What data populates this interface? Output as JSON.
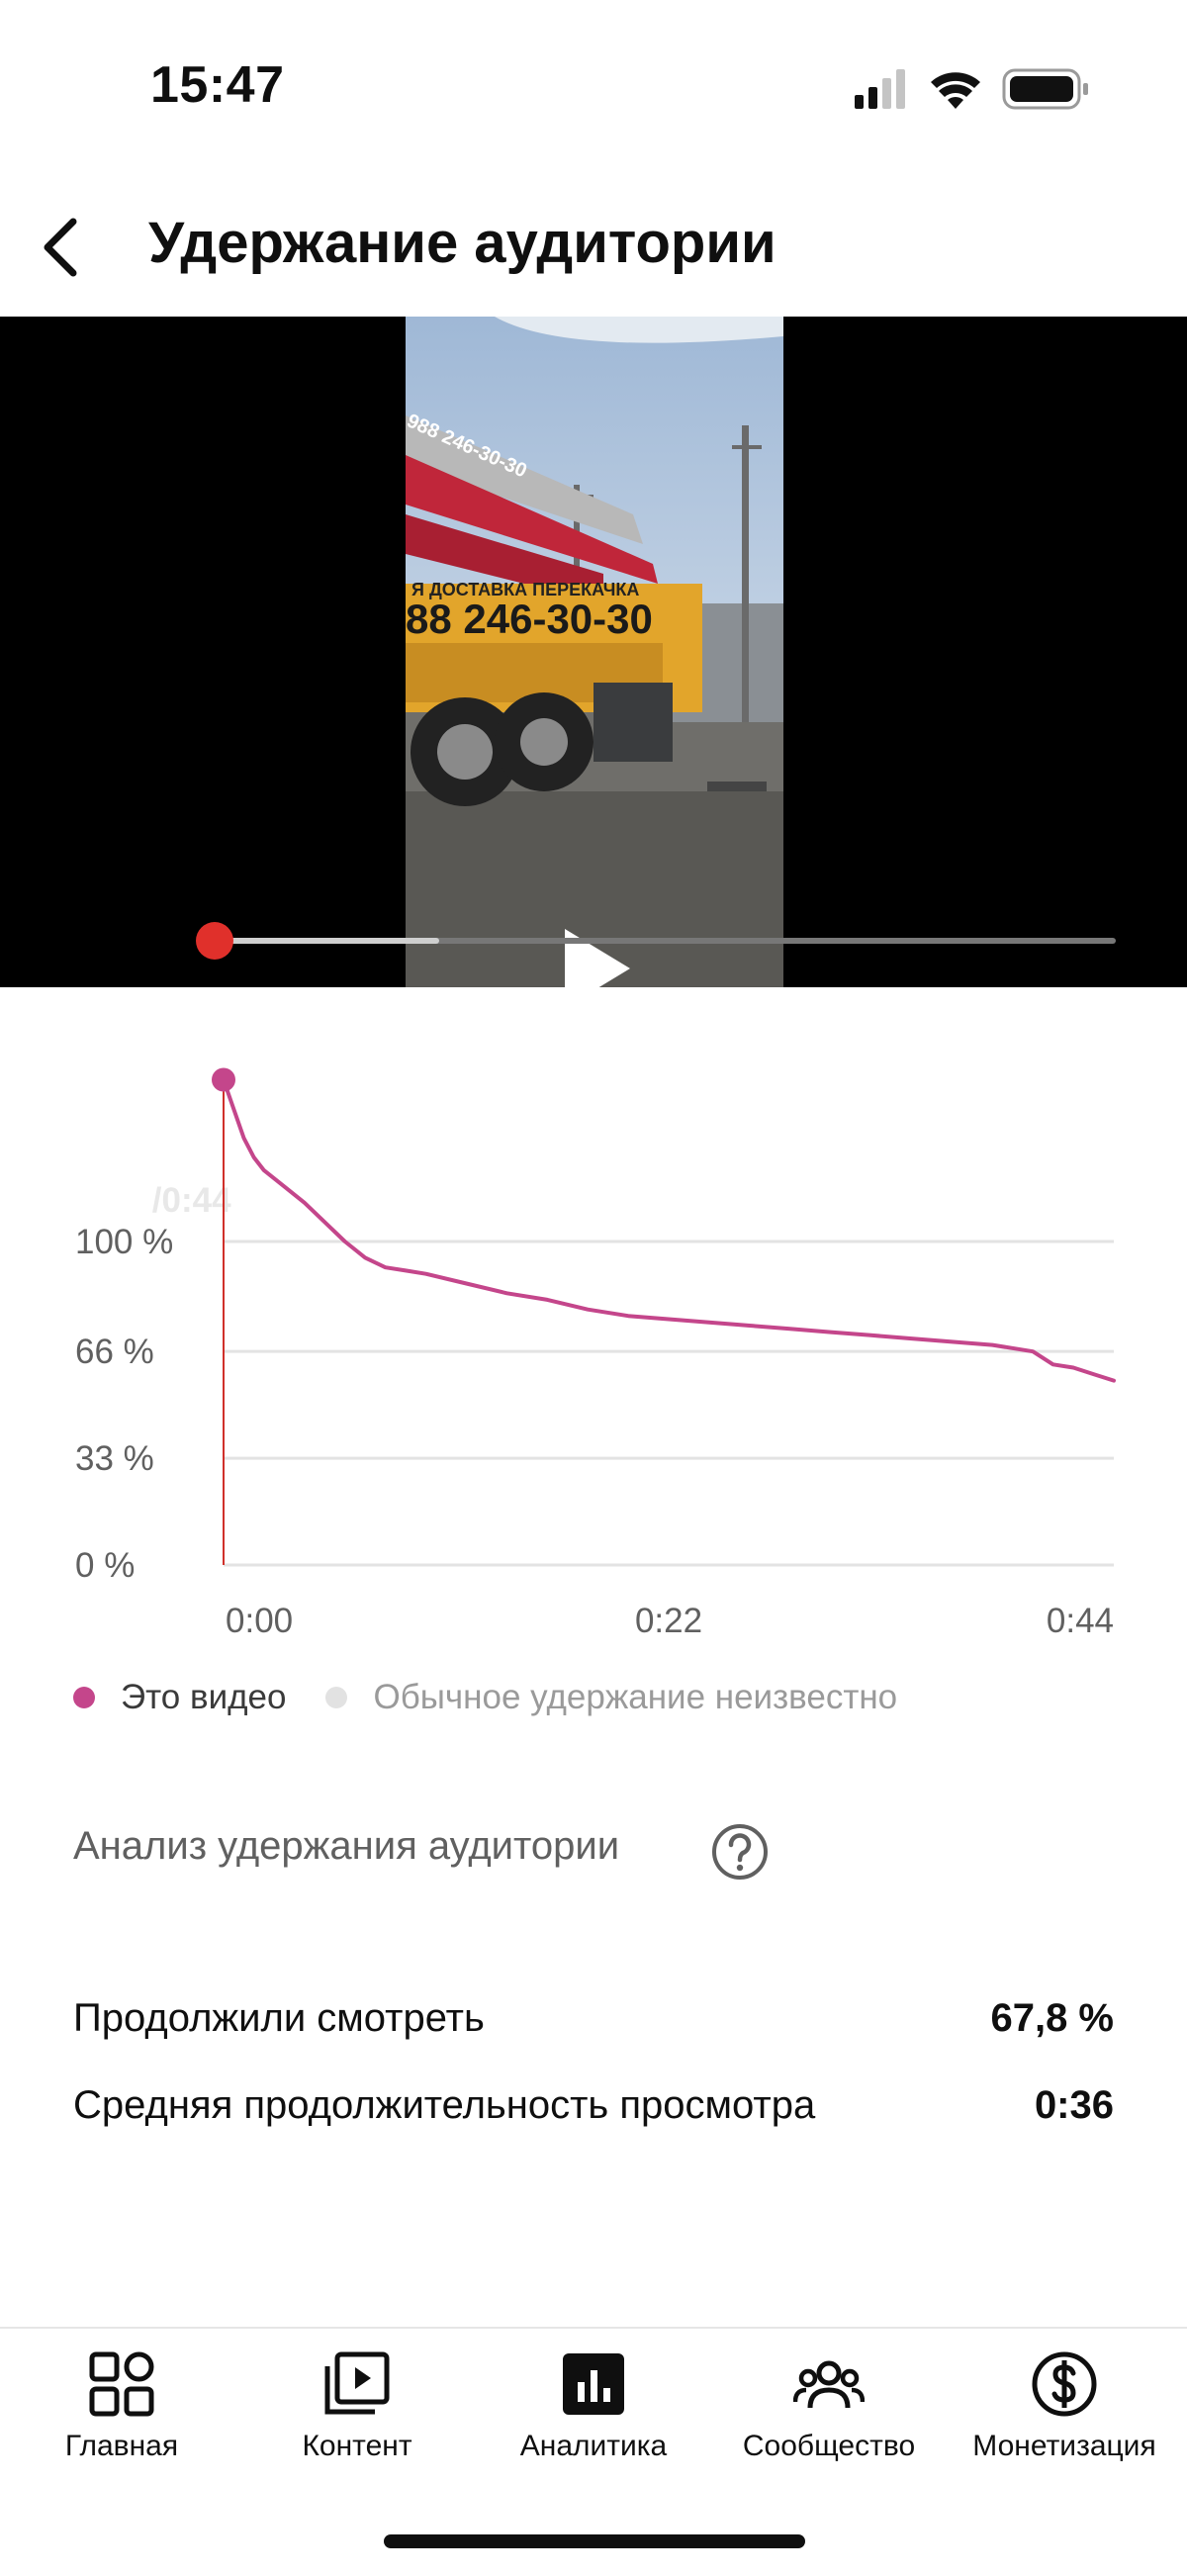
{
  "status_bar": {
    "time": "15:47"
  },
  "header": {
    "title": "Удержание аудитории"
  },
  "video": {
    "current_time": "0:00",
    "separator": "/",
    "duration": "0:44",
    "buffered_fraction": 0.25,
    "played_fraction": 0.0
  },
  "chart_data": {
    "type": "line",
    "title": "",
    "xlabel": "",
    "ylabel": "",
    "x_tick_labels": [
      "0:00",
      "0:22",
      "0:44"
    ],
    "y_tick_labels": [
      "100 %",
      "66 %",
      "33 %",
      "0 %"
    ],
    "y_ticks": [
      0,
      33,
      66,
      100
    ],
    "xlim": [
      0,
      44
    ],
    "ylim": [
      0,
      100
    ],
    "grid": true,
    "legend_position": "bottom-left",
    "series": [
      {
        "name": "Это видео",
        "color": "#c4468b",
        "x": [
          0,
          0.5,
          1,
          1.5,
          2,
          3,
          4,
          5,
          6,
          7,
          8,
          9,
          10,
          12,
          14,
          16,
          18,
          20,
          22,
          24,
          26,
          28,
          30,
          32,
          34,
          36,
          38,
          40,
          41,
          42,
          43,
          44
        ],
        "y": [
          150,
          141,
          132,
          126,
          122,
          117,
          112,
          106,
          100,
          95,
          92,
          91,
          90,
          87,
          84,
          82,
          79,
          77,
          76,
          75,
          74,
          73,
          72,
          71,
          70,
          69,
          68,
          66,
          62,
          61,
          59,
          57
        ]
      },
      {
        "name": "Обычное удержание неизвестно",
        "color": "#e2e2e2",
        "x": [],
        "y": []
      }
    ]
  },
  "analysis": {
    "title": "Анализ удержания аудитории",
    "stats": [
      {
        "label": "Продолжили смотреть",
        "value": "67,8 %"
      },
      {
        "label": "Средняя продолжительность просмотра",
        "value": "0:36"
      }
    ]
  },
  "nav": {
    "items": [
      {
        "label": "Главная",
        "icon": "home-grid-icon"
      },
      {
        "label": "Контент",
        "icon": "content-play-icon"
      },
      {
        "label": "Аналитика",
        "icon": "analytics-bar-icon",
        "active": true
      },
      {
        "label": "Сообщество",
        "icon": "community-people-icon"
      },
      {
        "label": "Монетизация",
        "icon": "monetization-dollar-icon"
      }
    ]
  }
}
